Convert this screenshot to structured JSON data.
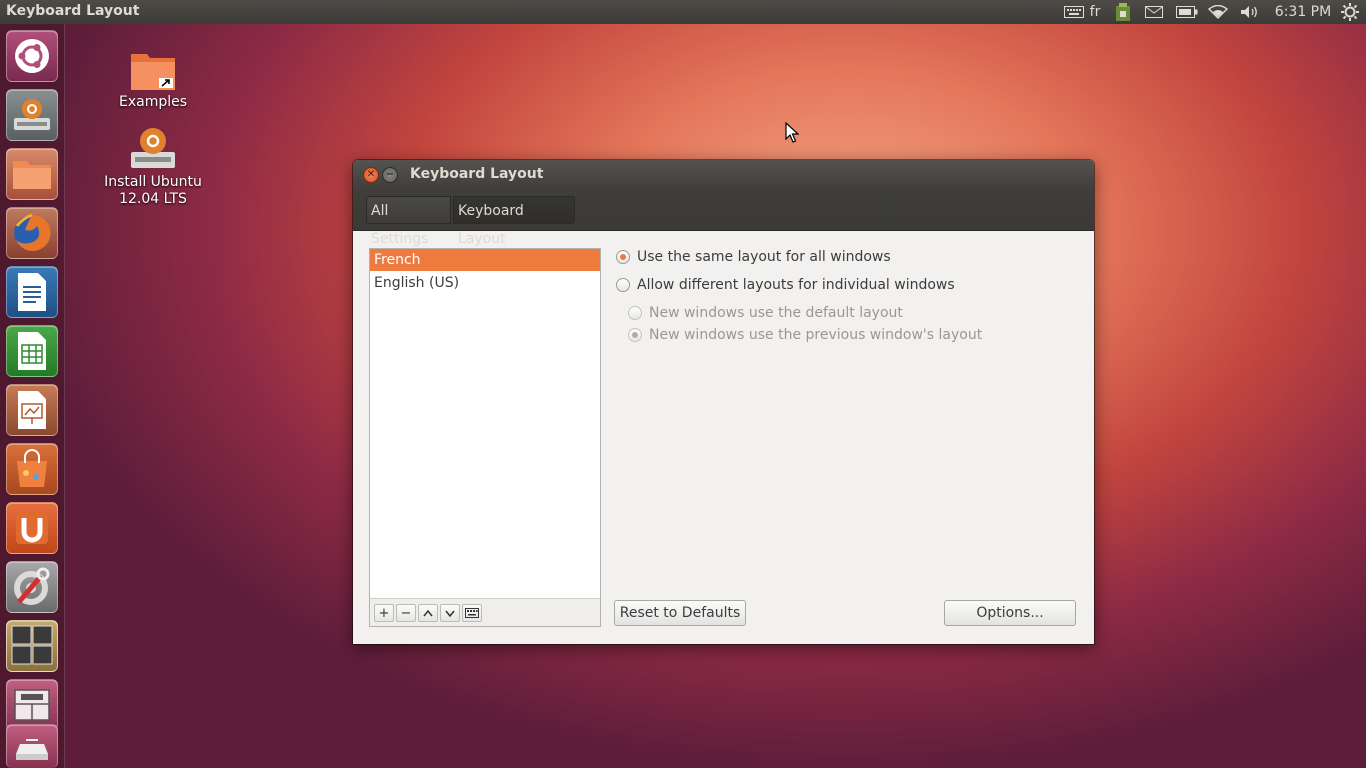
{
  "top_panel": {
    "app_title": "Keyboard Layout",
    "keyboard_indicator": "fr",
    "clock": "6:31 PM"
  },
  "launcher": {
    "items": [
      {
        "icon": "ubuntu-dash-icon"
      },
      {
        "icon": "install-ubuntu-icon"
      },
      {
        "icon": "files-folder-icon"
      },
      {
        "icon": "firefox-icon"
      },
      {
        "icon": "libreoffice-writer-icon"
      },
      {
        "icon": "libreoffice-calc-icon"
      },
      {
        "icon": "libreoffice-impress-icon"
      },
      {
        "icon": "software-center-icon"
      },
      {
        "icon": "ubuntu-one-icon"
      },
      {
        "icon": "system-settings-icon"
      },
      {
        "icon": "workspace-switcher-icon"
      },
      {
        "icon": "window-icon"
      },
      {
        "icon": "scanner-icon"
      }
    ]
  },
  "desktop": {
    "icons": [
      {
        "label": "Examples",
        "icon": "folder-link-icon"
      },
      {
        "label": "Install Ubuntu 12.04 LTS",
        "icon": "install-ubuntu-icon"
      }
    ]
  },
  "window": {
    "title": "Keyboard Layout",
    "breadcrumbs": [
      "All Settings",
      "Keyboard Layout"
    ],
    "layouts": [
      {
        "label": "French",
        "selected": true
      },
      {
        "label": "English (US)",
        "selected": false
      }
    ],
    "list_buttons": [
      {
        "symbol": "+",
        "icon": "add-icon"
      },
      {
        "symbol": "−",
        "icon": "remove-icon"
      },
      {
        "symbol": "⌃",
        "icon": "move-up-icon"
      },
      {
        "symbol": "⌄",
        "icon": "move-down-icon"
      },
      {
        "symbol": "⌨",
        "icon": "keyboard-preview-icon"
      }
    ],
    "options": {
      "same_layout": "Use the same layout for all windows",
      "different_layouts": "Allow different layouts for individual windows",
      "default_layout": "New windows use the default layout",
      "previous_layout": "New windows use the previous window's layout"
    },
    "reset_button": "Reset to Defaults",
    "options_button": "Options..."
  },
  "colors": {
    "accent": "#ef7a3d",
    "panel": "#3c3b37"
  }
}
